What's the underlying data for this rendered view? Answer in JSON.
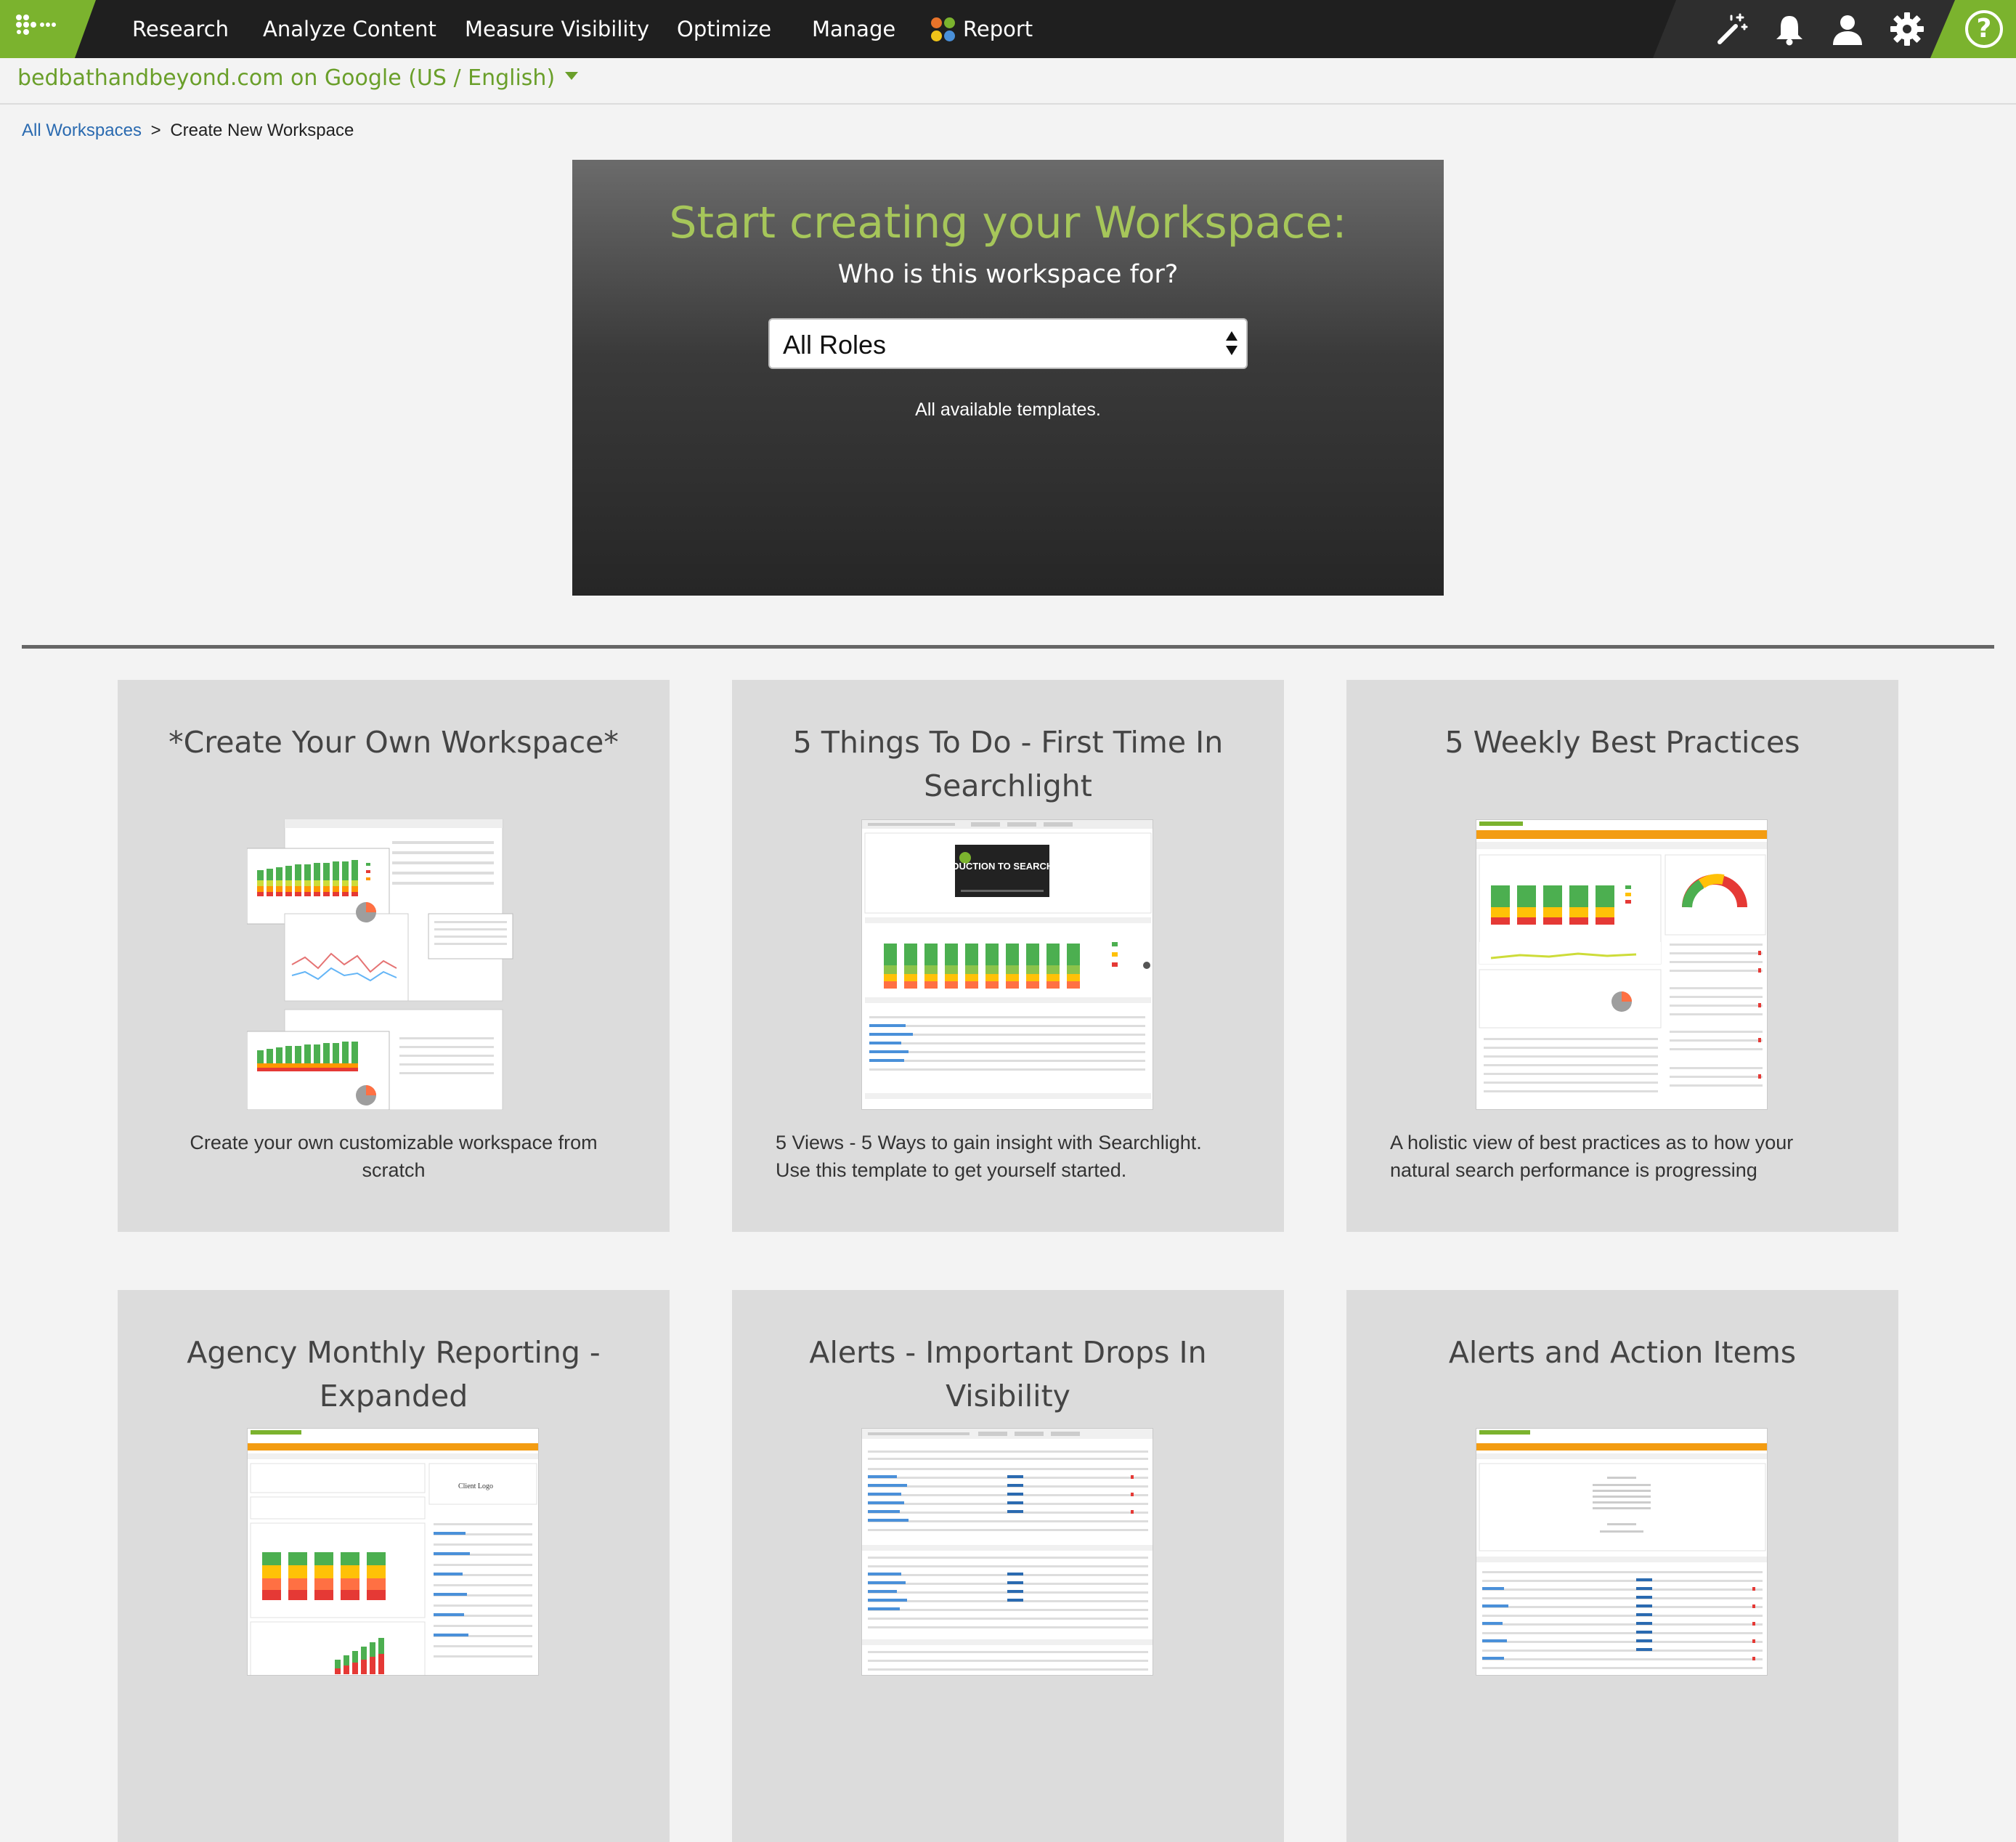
{
  "nav": {
    "items": [
      "Research",
      "Analyze Content",
      "Measure Visibility",
      "Optimize",
      "Manage",
      "Report"
    ],
    "report_icon_colors": [
      "#e8732a",
      "#7bb32e",
      "#f0c419",
      "#4a90d9"
    ],
    "accent": "#7bb32e",
    "icons": [
      "magic-wand-icon",
      "bell-icon",
      "user-icon",
      "gear-icon",
      "help-icon"
    ],
    "help_glyph": "?"
  },
  "site": {
    "selector": "bedbathandbeyond.com on Google (US / English)",
    "color": "#6a9f2a"
  },
  "breadcrumb": {
    "link": "All Workspaces",
    "separator": ">",
    "current": "Create New Workspace"
  },
  "hero": {
    "title": "Start creating your Workspace:",
    "subtitle": "Who is this workspace for?",
    "role_selected": "All Roles",
    "note": "All available templates.",
    "title_color": "#a6c65a"
  },
  "templates": [
    {
      "title": "*Create Your Own Workspace*",
      "description": "Create your own customizable workspace from scratch"
    },
    {
      "title": "5 Things To Do - First Time In Searchlight",
      "description": "5 Views - 5 Ways to gain insight with Searchlight. Use this template to get yourself started.",
      "thumb_caption": "INTRODUCTION TO SEARCHLIGHT"
    },
    {
      "title": "5 Weekly Best Practices",
      "description": "A holistic view of best practices as to how your natural search performance is progressing"
    },
    {
      "title": "Agency Monthly Reporting - Expanded",
      "description": "",
      "thumb_caption": "Client Logo"
    },
    {
      "title": "Alerts - Important Drops In Visibility",
      "description": ""
    },
    {
      "title": "Alerts and Action Items",
      "description": ""
    }
  ]
}
